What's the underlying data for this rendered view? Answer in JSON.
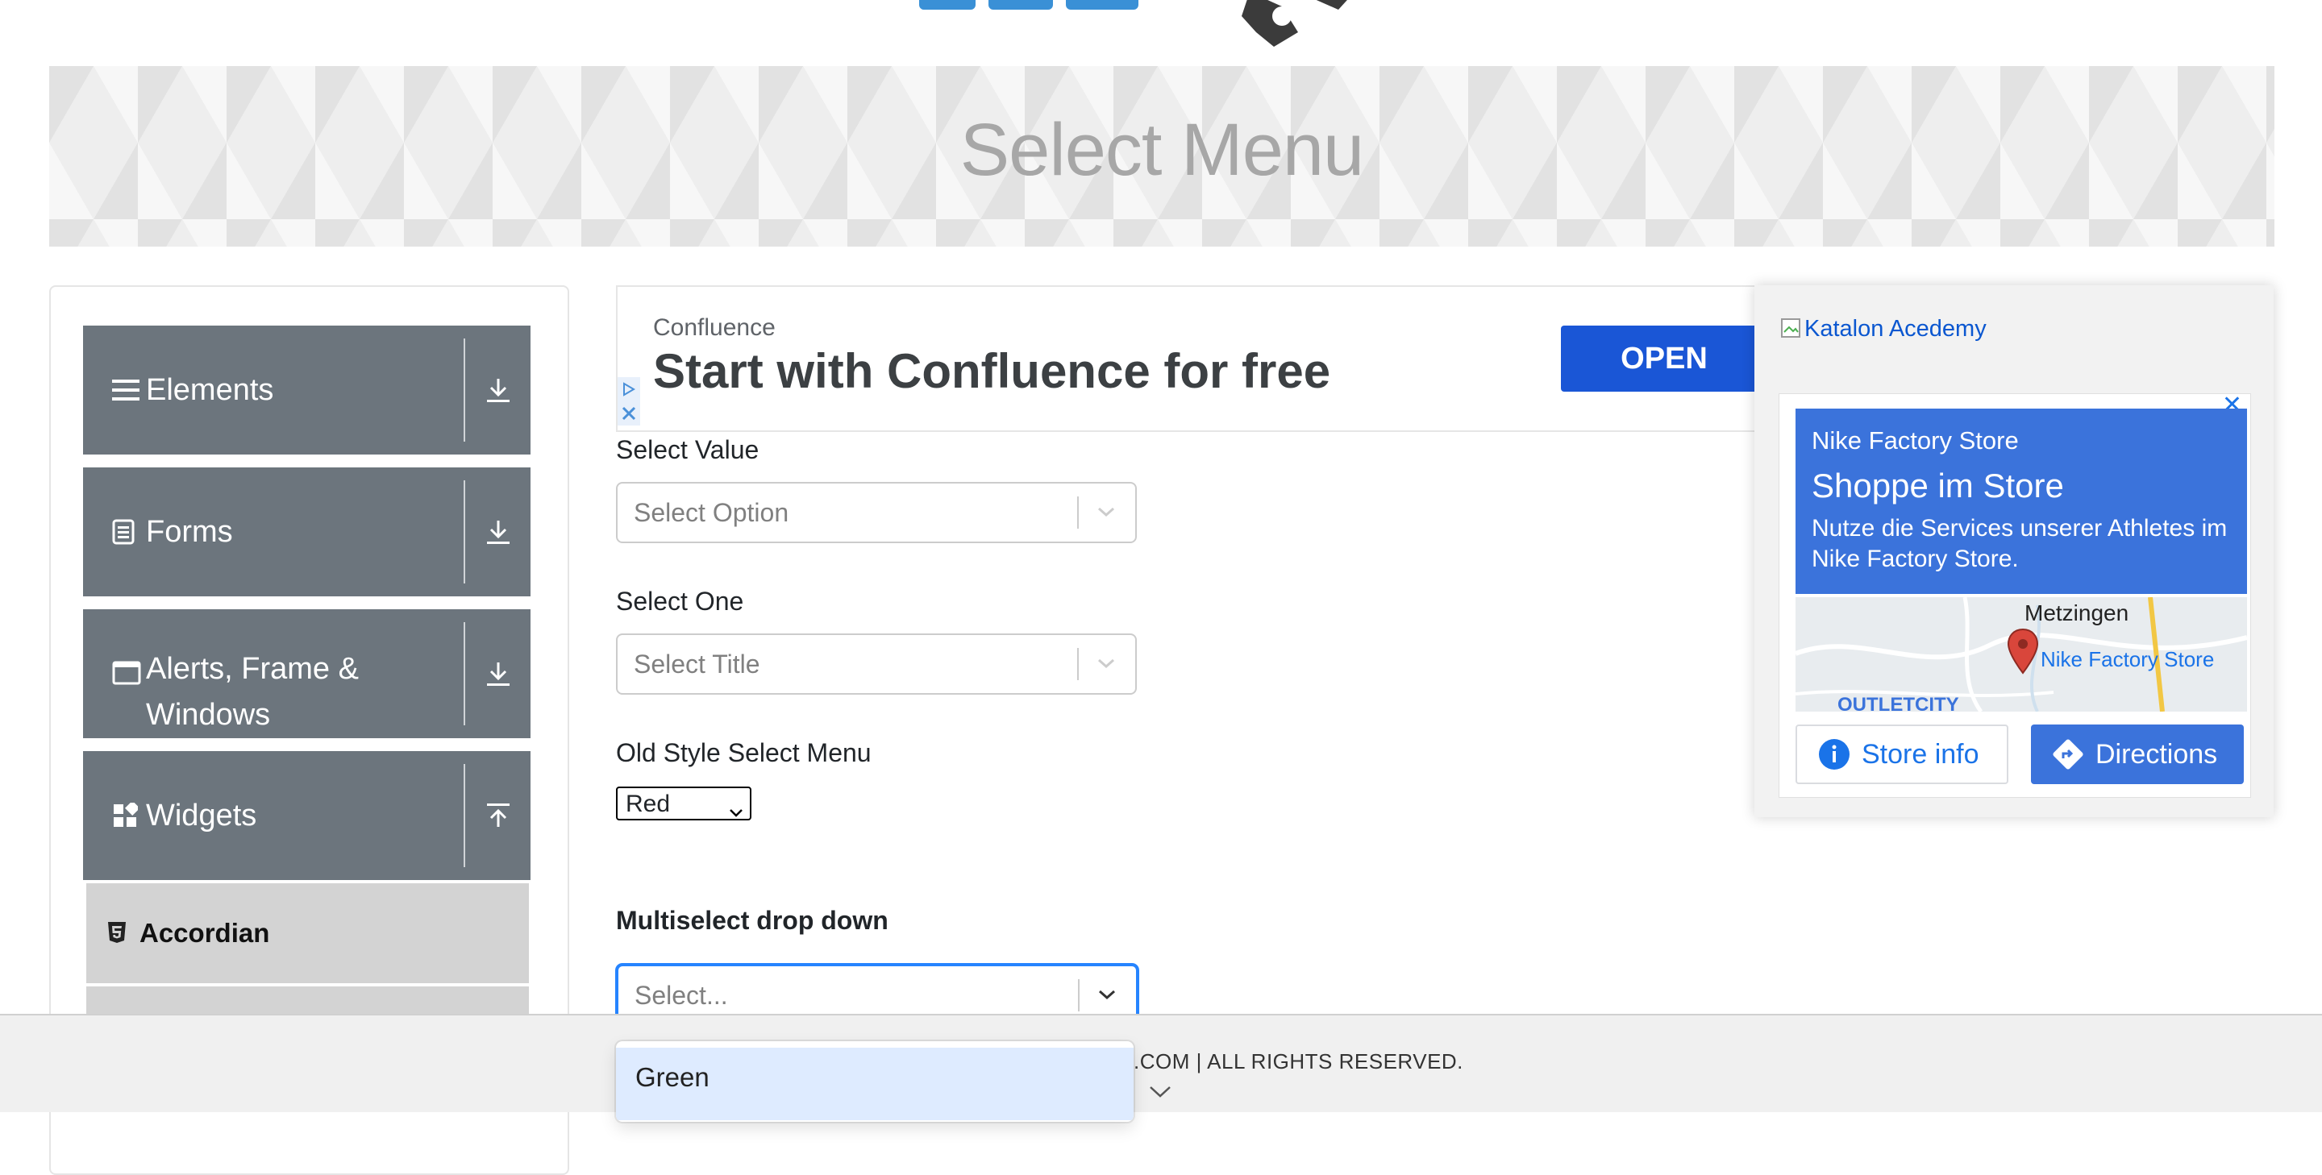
{
  "header": {
    "page_title": "Select Menu"
  },
  "sidebar": {
    "groups": [
      {
        "label": "Elements",
        "icon": "hamburger-icon",
        "arrow": "download-icon"
      },
      {
        "label": "Forms",
        "icon": "document-icon",
        "arrow": "download-icon"
      },
      {
        "label": "Alerts, Frame &",
        "label2": "Windows",
        "icon": "window-icon",
        "arrow": "download-icon"
      },
      {
        "label": "Widgets",
        "icon": "widgets-icon",
        "arrow": "upload-icon"
      }
    ],
    "active_item": {
      "label": "Accordian",
      "icon": "html5-icon"
    }
  },
  "ad_top": {
    "brand": "Confluence",
    "headline": "Start with Confluence for free",
    "button": "OPEN"
  },
  "form": {
    "select_value_label": "Select Value",
    "select_value_placeholder": "Select Option",
    "select_one_label": "Select One",
    "select_one_placeholder": "Select Title",
    "old_style_label": "Old Style Select Menu",
    "old_style_value": "Red",
    "multiselect_label": "Multiselect drop down",
    "multiselect_placeholder": "Select...",
    "dropdown_options": [
      "Green"
    ]
  },
  "right_ad": {
    "image_alt": "Katalon Acedemy",
    "map_ad": {
      "store_name": "Nike Factory Store",
      "headline": "Shoppe im Store",
      "body": "Nutze die Services unserer Athletes im Nike Factory Store.",
      "map_city": "Metzingen",
      "map_pin_label": "Nike Factory Store",
      "map_area": "OUTLETCITY",
      "btn_info": "Store info",
      "btn_directions": "Directions"
    }
  },
  "footer": {
    "text": ".COM | ALL RIGHTS RESERVED."
  },
  "colors": {
    "sidebar_group": "#6c757d",
    "active_item": "#d3d3d3",
    "ad_button": "#1a56d6",
    "focus_border": "#2684ff",
    "option_highlight": "#deebff",
    "map_blue": "#3b73db"
  }
}
